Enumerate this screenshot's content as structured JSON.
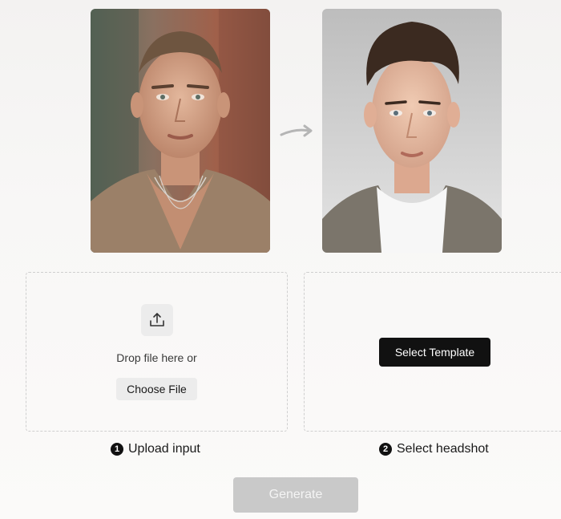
{
  "images": {
    "input_photo": "portrait-input-photo",
    "output_photo": "portrait-headshot-photo"
  },
  "upload": {
    "icon": "upload-icon",
    "drop_text": "Drop file here or",
    "choose_label": "Choose File"
  },
  "template": {
    "select_label": "Select Template"
  },
  "steps": [
    {
      "number": "1",
      "label": "Upload input"
    },
    {
      "number": "2",
      "label": "Select headshot"
    }
  ],
  "generate": {
    "label": "Generate",
    "disabled": true
  },
  "colors": {
    "primary_button": "#111111",
    "disabled_button": "#c9c9c9",
    "dashed_border": "#cfcfcf",
    "secondary_button": "#ececec"
  }
}
